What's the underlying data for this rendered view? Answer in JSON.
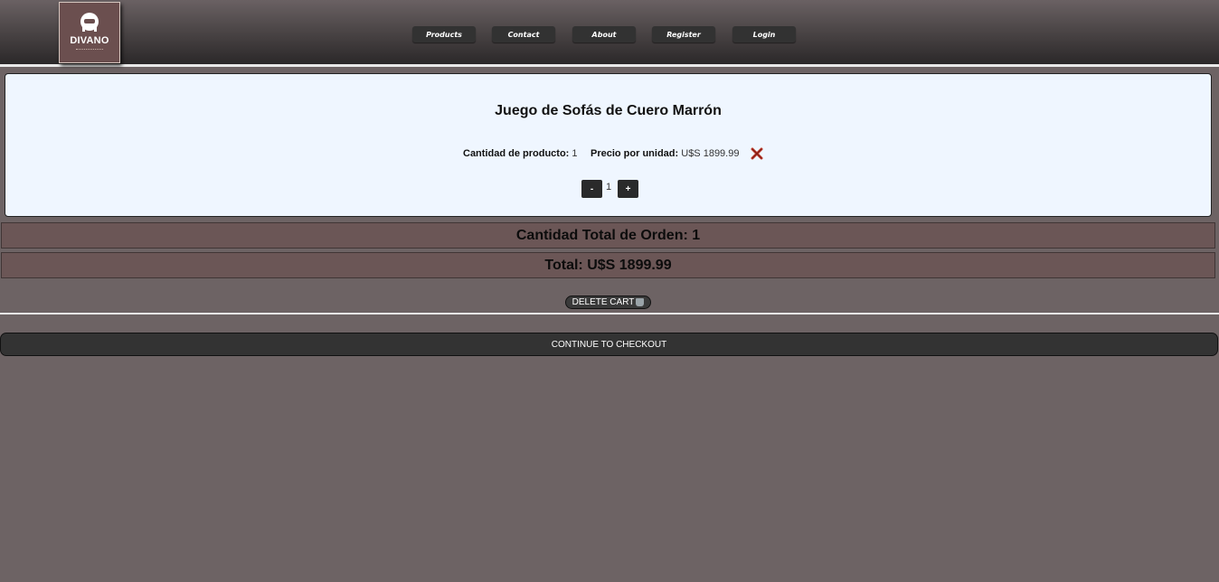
{
  "brand": {
    "name": "DIVANO"
  },
  "nav": {
    "items": [
      {
        "label": "Products"
      },
      {
        "label": "Contact"
      },
      {
        "label": "About"
      },
      {
        "label": "Register"
      },
      {
        "label": "Login"
      }
    ]
  },
  "cart_item": {
    "title": "Juego de Sofás de Cuero Marrón",
    "qty_label": "Cantidad de producto:",
    "qty_value": "1",
    "price_label": "Precio por unidad:",
    "price_value": "U$S 1899.99",
    "remove_icon": "close-icon",
    "stepper": {
      "minus": "-",
      "value": "1",
      "plus": "+"
    }
  },
  "summary": {
    "total_qty": "Cantidad Total de Orden: 1",
    "total_price": "Total: U$S 1899.99"
  },
  "actions": {
    "delete_cart": "DELETE CART",
    "checkout": "CONTINUE TO CHECKOUT"
  },
  "colors": {
    "page_bg": "#6d6364",
    "card_bg": "#eff6ff",
    "summary_bg": "#6b5656",
    "remove_icon": "#c0392b"
  }
}
